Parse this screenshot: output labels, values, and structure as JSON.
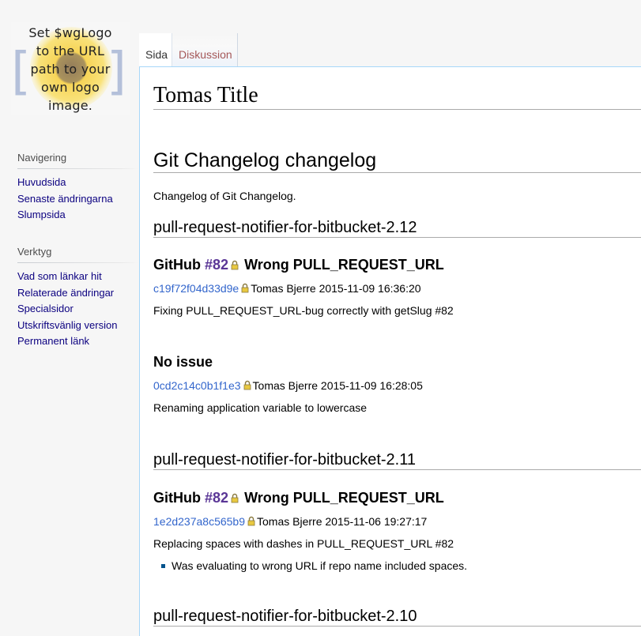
{
  "logo": {
    "text_lines": [
      "Set $wgLogo",
      "to the URL",
      "path to your",
      "own logo",
      "image."
    ]
  },
  "sidebar": {
    "nav_heading": "Navigering",
    "nav_items": [
      "Huvudsida",
      "Senaste ändringarna",
      "Slumpsida"
    ],
    "tools_heading": "Verktyg",
    "tools_items": [
      "Vad som länkar hit",
      "Relaterade ändringar",
      "Specialsidor",
      "Utskriftsvänlig version",
      "Permanent länk"
    ]
  },
  "tabs": {
    "page": "Sida",
    "discussion": "Diskussion"
  },
  "page": {
    "title": "Tomas Title",
    "heading": "Git Changelog changelog",
    "intro": "Changelog of Git Changelog.",
    "sections": [
      {
        "version": "pull-request-notifier-for-bitbucket-2.12",
        "entries": [
          {
            "prefix": "GitHub",
            "issue": "#82",
            "title": "Wrong PULL_REQUEST_URL",
            "hash": "c19f72f04d33d9e",
            "meta": "Tomas Bjerre 2015-11-09 16:36:20",
            "message": "Fixing PULL_REQUEST_URL-bug correctly with getSlug #82"
          },
          {
            "title": "No issue",
            "hash": "0cd2c14c0b1f1e3",
            "meta": "Tomas Bjerre 2015-11-09 16:28:05",
            "message": "Renaming application variable to lowercase"
          }
        ]
      },
      {
        "version": "pull-request-notifier-for-bitbucket-2.11",
        "entries": [
          {
            "prefix": "GitHub",
            "issue": "#82",
            "title": "Wrong PULL_REQUEST_URL",
            "hash": "1e2d237a8c565b9",
            "meta": "Tomas Bjerre 2015-11-06 19:27:17",
            "message": "Replacing spaces with dashes in PULL_REQUEST_URL #82",
            "bullets": [
              "Was evaluating to wrong URL if repo name included spaces."
            ]
          }
        ]
      },
      {
        "version": "pull-request-notifier-for-bitbucket-2.10"
      }
    ]
  },
  "colors": {
    "link": "#3366cc",
    "nav_link": "#0b0080",
    "issue": "#5a3696",
    "tab_new": "#a55858",
    "border": "#a7d7f9"
  },
  "icons": {
    "lock": "lock-icon",
    "bullet": "bullet-icon"
  }
}
